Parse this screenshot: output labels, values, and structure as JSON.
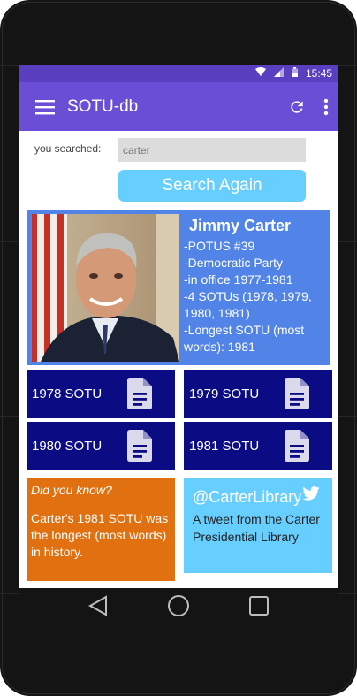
{
  "status_bar": {
    "time": "15:45"
  },
  "app_bar": {
    "title": "SOTU-db"
  },
  "search": {
    "label": "you searched:",
    "query": "carter",
    "button_label": "Search Again"
  },
  "profile": {
    "name": "Jimmy Carter",
    "facts": [
      "-POTUS #39",
      "-Democratic Party",
      "-in office 1977-1981",
      "-4 SOTUs (1978, 1979, 1980, 1981)",
      "-Longest SOTU (most words): 1981"
    ]
  },
  "sotu_cards": [
    {
      "label": "1978 SOTU"
    },
    {
      "label": "1979 SOTU"
    },
    {
      "label": "1980 SOTU"
    },
    {
      "label": "1981 SOTU"
    }
  ],
  "did_you_know": {
    "heading": "Did you know?",
    "body": "Carter's 1981 SOTU was the longest (most words) in history."
  },
  "tweet": {
    "handle": "@CarterLibrary",
    "description": "A tweet from the Carter Presidential Library"
  },
  "icons": {
    "menu": "menu-icon",
    "refresh": "refresh-icon",
    "more": "more-vert-icon",
    "document": "document-icon",
    "twitter": "twitter-bird-icon",
    "back": "back-triangle-icon",
    "home": "home-circle-icon",
    "recents": "recents-square-icon"
  },
  "colors": {
    "status_bar": "#5a3fc0",
    "app_bar": "#6a4fd6",
    "search_button": "#66cfff",
    "profile_card": "#5184e6",
    "sotu_card": "#0b0b83",
    "did_you_know_card": "#e07010",
    "tweet_card": "#66cfff"
  }
}
